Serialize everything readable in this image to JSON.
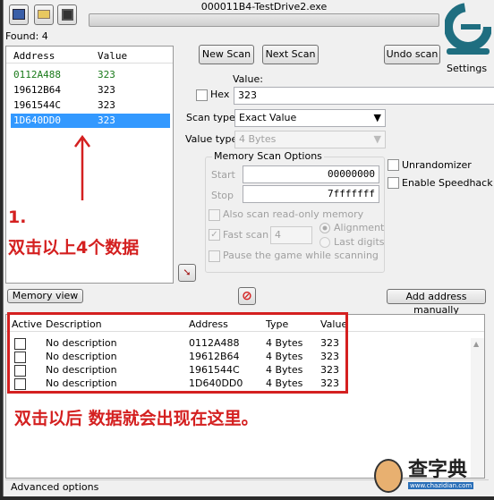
{
  "window": {
    "title": "000011B4-TestDrive2.exe",
    "found_label": "Found: 4"
  },
  "toolbar": {
    "icons": [
      "process-select-icon",
      "open-folder-icon",
      "save-icon"
    ]
  },
  "results": {
    "headers": [
      "Address",
      "Value"
    ],
    "rows": [
      {
        "address": "0112A488",
        "value": "323",
        "color": "#1a7a1a"
      },
      {
        "address": "19612B64",
        "value": "323"
      },
      {
        "address": "1961544C",
        "value": "323"
      },
      {
        "address": "1D640DD0",
        "value": "323",
        "selected": true
      }
    ]
  },
  "annotations": {
    "step": "1.",
    "step_text": "双击以上4个数据",
    "result_text": "双击以后 数据就会出现在这里。",
    "color": "#d42020"
  },
  "scan": {
    "new_scan": "New Scan",
    "next_scan": "Next Scan",
    "undo_scan": "Undo scan",
    "settings": "Settings",
    "value_label": "Value:",
    "hex_label": "Hex",
    "value": "323",
    "scan_type_label": "Scan type",
    "scan_type": "Exact Value",
    "value_type_label": "Value type",
    "value_type": "4 Bytes"
  },
  "memory": {
    "title": "Memory Scan Options",
    "start_label": "Start",
    "start": "00000000",
    "stop_label": "Stop",
    "stop": "7fffffff",
    "readonly": "Also scan read-only memory",
    "fast_scan": "Fast scan",
    "fast_value": "4",
    "alignment": "Alignment",
    "last_digits": "Last digits",
    "pause": "Pause the game while scanning"
  },
  "options": {
    "unrandomizer": "Unrandomizer",
    "speedhack": "Enable Speedhack"
  },
  "buttons": {
    "memory_view": "Memory view",
    "add_address": "Add address manually"
  },
  "table": {
    "headers": [
      "Active",
      "Description",
      "Address",
      "Type",
      "Value"
    ],
    "rows": [
      {
        "description": "No description",
        "address": "0112A488",
        "type": "4 Bytes",
        "value": "323"
      },
      {
        "description": "No description",
        "address": "19612B64",
        "type": "4 Bytes",
        "value": "323"
      },
      {
        "description": "No description",
        "address": "1961544C",
        "type": "4 Bytes",
        "value": "323"
      },
      {
        "description": "No description",
        "address": "1D640DD0",
        "type": "4 Bytes",
        "value": "323"
      }
    ]
  },
  "footer": {
    "advanced": "Advanced options"
  },
  "watermark": {
    "text": "查字典",
    "url": "www.chazidian.com"
  }
}
